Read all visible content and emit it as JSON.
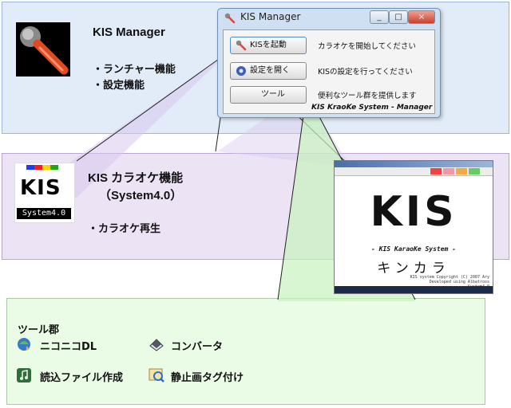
{
  "manager": {
    "title": "KIS Manager",
    "features": [
      "・ランチャー機能",
      "・設定機能"
    ]
  },
  "window": {
    "title": "KIS Manager",
    "caption_buttons": [
      "_",
      "□",
      "×"
    ],
    "buttons": [
      {
        "label": "KISを起動",
        "desc": "カラオケを開始してください",
        "icon": "microphone-icon"
      },
      {
        "label": "設定を開く",
        "desc": "KISの設定を行ってください",
        "icon": "settings-icon"
      },
      {
        "label": "ツール",
        "desc": "便利なツール群を提供します",
        "icon": "none"
      }
    ],
    "footer": "KIS KraoKe System - Manager"
  },
  "karaoke": {
    "title": "KIS カラオケ機能",
    "subtitle": "（System4.0）",
    "features": [
      "・カラオケ再生"
    ],
    "logo_text": "KIS",
    "logo_sub": "System4.0",
    "logo_colors": [
      "#1a3cff",
      "#ff1a1a",
      "#ffd400",
      "#1aa81a"
    ]
  },
  "player": {
    "big_text": "KIS",
    "system_text": "- KIS KaraoKe System -",
    "kana_text": "キンカラ",
    "copyright": [
      "KIS system Copyright (C) 2007 Ary",
      "Developed using Albatross System4.0"
    ]
  },
  "tools": {
    "title": "ツール郡",
    "items": [
      {
        "label": "ニコニコDL",
        "icon": "nico-download-icon"
      },
      {
        "label": "コンバータ",
        "icon": "converter-icon"
      },
      {
        "label": "読込ファイル作成",
        "icon": "music-file-icon"
      },
      {
        "label": "静止画タグ付け",
        "icon": "image-tag-icon"
      }
    ]
  }
}
